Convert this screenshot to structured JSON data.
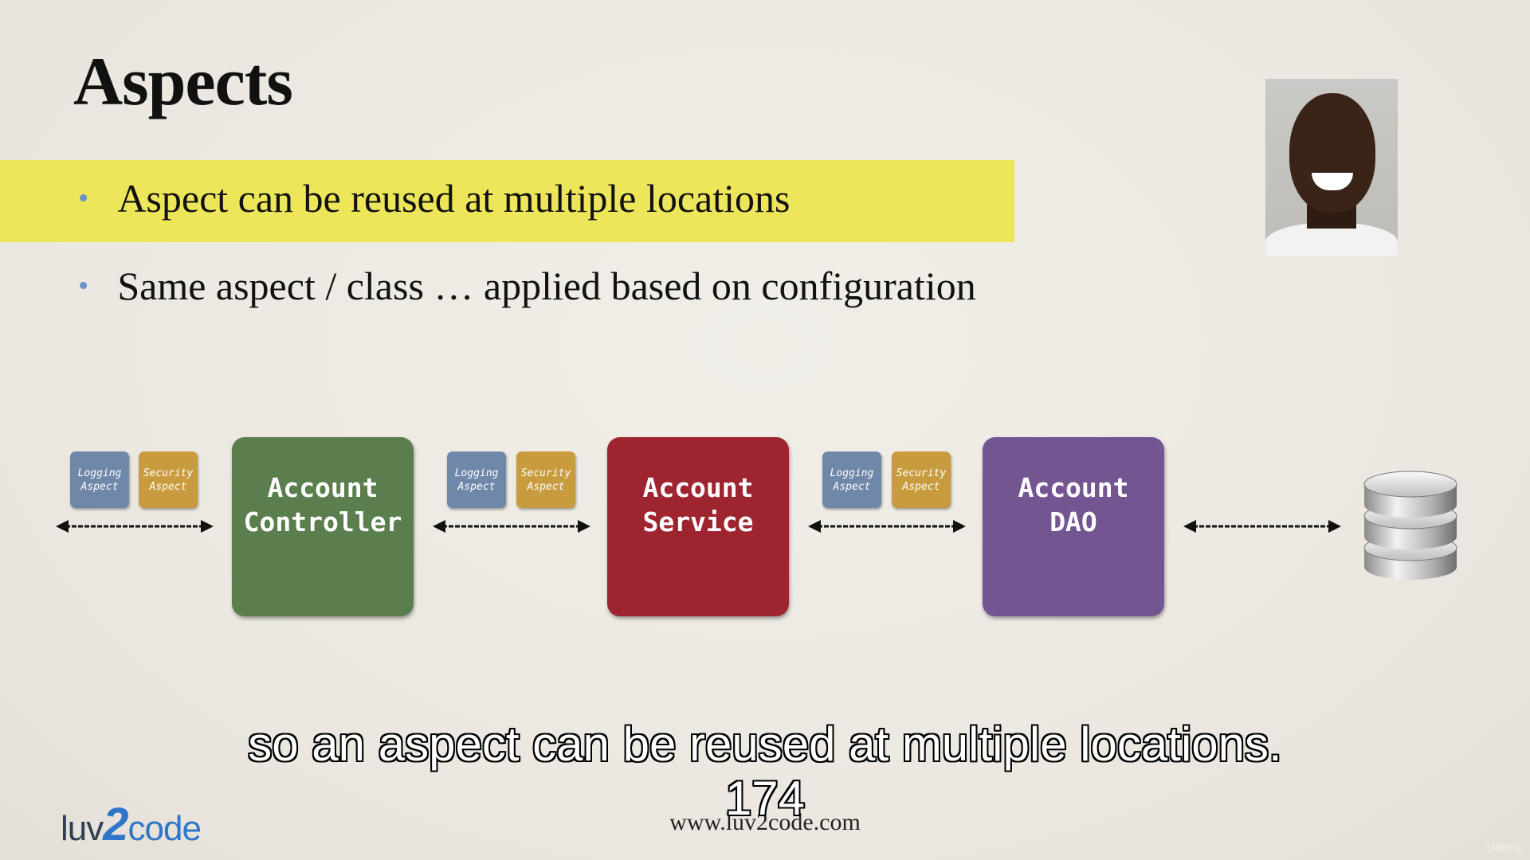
{
  "slide": {
    "title": "Aspects",
    "bullets": [
      "Aspect can be reused at multiple locations",
      "Same aspect / class … applied based on configuration"
    ],
    "bullet_glyph": "•",
    "highlight_color": "#ede65a"
  },
  "diagram": {
    "aspect_pairs": [
      {
        "logging": "Logging Aspect",
        "security": "Security Aspect"
      },
      {
        "logging": "Logging Aspect",
        "security": "Security Aspect"
      },
      {
        "logging": "Logging Aspect",
        "security": "Security Aspect"
      }
    ],
    "components": [
      {
        "line1": "Account",
        "line2": "Controller",
        "color": "#5a7e4d"
      },
      {
        "line1": "Account",
        "line2": "Service",
        "color": "#9e2430"
      },
      {
        "line1": "Account",
        "line2": "DAO",
        "color": "#735591"
      }
    ],
    "database_icon": "database-icon"
  },
  "captions": {
    "line1": "so an aspect can be reused at multiple locations.",
    "line2": "174"
  },
  "footer": {
    "url": "www.luv2code.com",
    "logo_pre": "luv",
    "logo_two": "2",
    "logo_post": "code",
    "watermark": "Udemy"
  }
}
